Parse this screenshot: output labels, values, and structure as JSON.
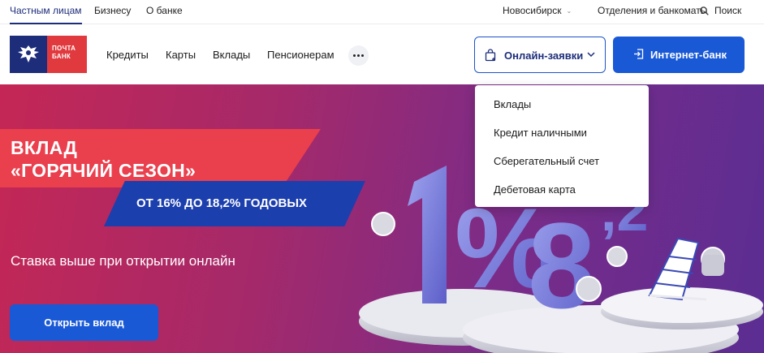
{
  "topbar": {
    "segments": [
      "Частным лицам",
      "Бизнесу",
      "О банке"
    ],
    "city": "Новосибирск",
    "atm_link": "Отделения и банкоматы",
    "search": "Поиск"
  },
  "header": {
    "logo_text_line1": "ПОЧТА",
    "logo_text_line2": "БАНК",
    "nav": [
      "Кредиты",
      "Карты",
      "Вклады",
      "Пенсионерам"
    ],
    "online_button": "Онлайн-заявки",
    "bank_button": "Интернет-банк"
  },
  "dropdown": {
    "items": [
      "Вклады",
      "Кредит наличными",
      "Сберегательный счет",
      "Дебетовая карта"
    ]
  },
  "hero": {
    "title_line1": "ВКЛАД",
    "title_line2": "«ГОРЯЧИЙ СЕЗОН»",
    "rate": "ОТ 16% ДО 18,2% ГОДОВЫХ",
    "subtitle": "Ставка выше при открытии онлайн",
    "cta": "Открыть вклад"
  },
  "colors": {
    "brand_blue": "#1d2d7a",
    "button_blue": "#1959d6",
    "brand_red": "#e03a3e"
  }
}
